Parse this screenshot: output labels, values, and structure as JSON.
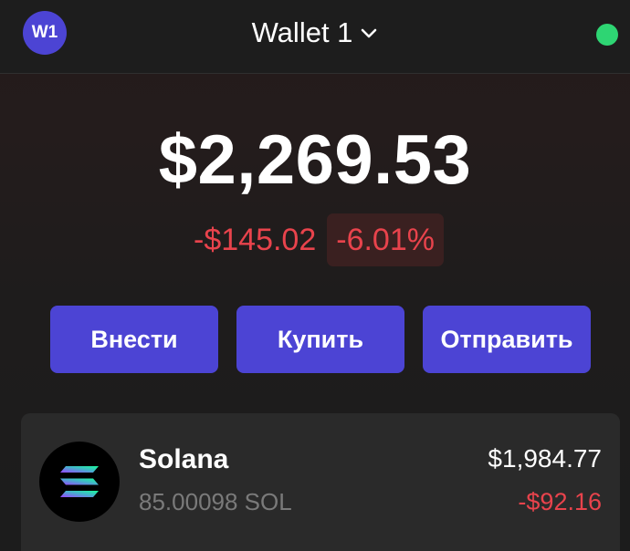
{
  "header": {
    "avatar_initials": "W1",
    "wallet_name": "Wallet 1",
    "status_color": "#2ed573"
  },
  "balance": {
    "total": "$2,269.53",
    "change_amount": "-$145.02",
    "change_percent": "-6.01%"
  },
  "actions": [
    {
      "label": "Внести"
    },
    {
      "label": "Купить"
    },
    {
      "label": "Отправить"
    }
  ],
  "tokens": [
    {
      "name": "Solana",
      "amount": "85.00098 SOL",
      "value": "$1,984.77",
      "change": "-$92.16",
      "icon": "solana-logo-icon"
    }
  ],
  "colors": {
    "accent": "#4c44d4",
    "negative": "#e8434c",
    "online": "#2ed573"
  }
}
